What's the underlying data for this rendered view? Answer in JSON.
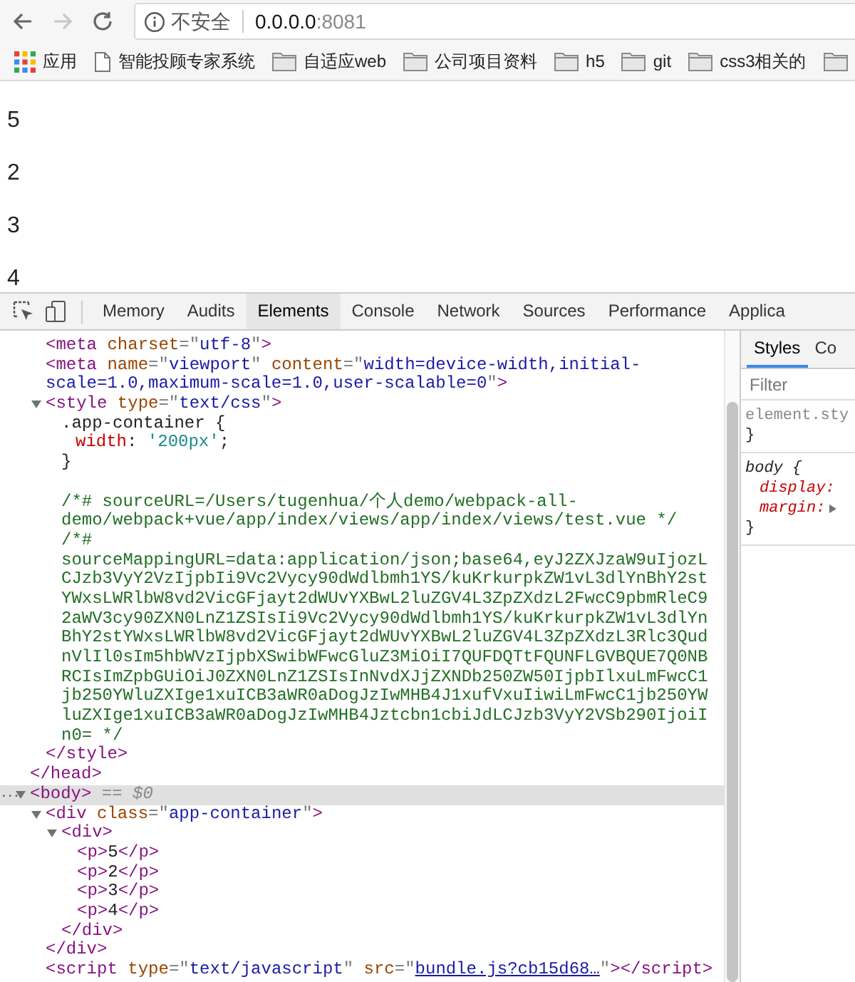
{
  "browser": {
    "nav_buttons": [
      {
        "kind": "back",
        "disabled": false
      },
      {
        "kind": "forward",
        "disabled": true
      },
      {
        "kind": "reload",
        "disabled": false
      }
    ],
    "security_label": "不安全",
    "url_host": "0.0.0.0",
    "url_port": ":8081"
  },
  "bookmarks": [
    {
      "kind": "apps",
      "label": "应用"
    },
    {
      "kind": "page",
      "label": "智能投顾专家系统"
    },
    {
      "kind": "folder",
      "label": "自适应web"
    },
    {
      "kind": "folder",
      "label": "公司项目资料"
    },
    {
      "kind": "folder",
      "label": "h5"
    },
    {
      "kind": "folder",
      "label": "git"
    },
    {
      "kind": "folder",
      "label": "css3相关的"
    },
    {
      "kind": "folder"
    }
  ],
  "page": {
    "paragraphs": [
      "5",
      "2",
      "3",
      "4"
    ]
  },
  "devtools": {
    "tabs": [
      {
        "label": "Memory",
        "selected": false
      },
      {
        "label": "Audits",
        "selected": false
      },
      {
        "label": "Elements",
        "selected": true
      },
      {
        "label": "Console",
        "selected": false
      },
      {
        "label": "Network",
        "selected": false
      },
      {
        "label": "Sources",
        "selected": false
      },
      {
        "label": "Performance",
        "selected": false
      },
      {
        "label": "Applica",
        "selected": false
      }
    ],
    "dom_tree": [
      {
        "selected": false,
        "children": [
          {
            "selected": false,
            "lines": [
              {
                "parts": [
                  {
                    "kind": "tag",
                    "text": "<meta"
                  },
                  {
                    "kind": "attr",
                    "text": " charset"
                  },
                  {
                    "kind": "punct",
                    "text": "=\""
                  },
                  {
                    "kind": "value",
                    "text": "utf-8"
                  },
                  {
                    "kind": "punct",
                    "text": "\""
                  },
                  {
                    "kind": "tag",
                    "text": ">"
                  }
                ]
              }
            ]
          },
          {
            "selected": false,
            "lines": [
              {
                "parts": [
                  {
                    "kind": "tag",
                    "text": "<meta"
                  },
                  {
                    "kind": "attr",
                    "text": " name"
                  },
                  {
                    "kind": "punct",
                    "text": "=\""
                  },
                  {
                    "kind": "value",
                    "text": "viewport"
                  },
                  {
                    "kind": "punct",
                    "text": "\""
                  },
                  {
                    "kind": "attr",
                    "text": " content"
                  },
                  {
                    "kind": "punct",
                    "text": "=\""
                  },
                  {
                    "kind": "value",
                    "text": "width=device-width,initial-"
                  }
                ]
              },
              {
                "parts": [
                  {
                    "kind": "value",
                    "text": "scale=1.0,maximum-scale=1.0,user-scalable=0"
                  },
                  {
                    "kind": "punct",
                    "text": "\""
                  },
                  {
                    "kind": "tag",
                    "text": ">"
                  }
                ]
              }
            ]
          },
          {
            "selected": false,
            "expanded": true,
            "lines": [
              {
                "parts": [
                  {
                    "kind": "tag",
                    "text": "<style"
                  },
                  {
                    "kind": "attr",
                    "text": " type"
                  },
                  {
                    "kind": "punct",
                    "text": "=\""
                  },
                  {
                    "kind": "value",
                    "text": "text/css"
                  },
                  {
                    "kind": "punct",
                    "text": "\""
                  },
                  {
                    "kind": "tag",
                    "text": ">"
                  }
                ]
              }
            ],
            "children": [
              {
                "selected": false,
                "lines": [
                  {
                    "parts": [
                      {
                        "kind": "selector",
                        "text": ".app-container {"
                      }
                    ]
                  },
                  {
                    "indented": true,
                    "parts": [
                      {
                        "kind": "property",
                        "text": "width"
                      },
                      {
                        "kind": "text",
                        "text": ": "
                      },
                      {
                        "kind": "string",
                        "text": "'200px'"
                      },
                      {
                        "kind": "text",
                        "text": ";"
                      }
                    ]
                  },
                  {
                    "parts": [
                      {
                        "kind": "text",
                        "text": "}"
                      }
                    ]
                  }
                ]
              },
              {
                "selected": false,
                "blank_before": true,
                "lines": [
                  {
                    "parts": [
                      {
                        "kind": "comment",
                        "text": "/*# sourceURL=/Users/tugenhua/个人demo/webpack-all-"
                      }
                    ]
                  },
                  {
                    "parts": [
                      {
                        "kind": "comment",
                        "text": "demo/webpack+vue/app/index/views/app/index/views/test.vue */"
                      }
                    ]
                  },
                  {
                    "parts": [
                      {
                        "kind": "comment",
                        "text": "/*#"
                      }
                    ]
                  },
                  {
                    "parts": [
                      {
                        "kind": "comment",
                        "text": "sourceMappingURL=data:application/json;base64,eyJ2ZXJzaW9uIjozL"
                      }
                    ]
                  },
                  {
                    "parts": [
                      {
                        "kind": "comment",
                        "text": "CJzb3VyY2VzIjpbIi9Vc2Vycy90dWdlbmh1YS/kuKrkurpkZW1vL3dlYnBhY2st"
                      }
                    ]
                  },
                  {
                    "parts": [
                      {
                        "kind": "comment",
                        "text": "YWxsLWRlbW8vd2VicGFjayt2dWUvYXBwL2luZGV4L3ZpZXdzL2FwcC9pbmRleC9"
                      }
                    ]
                  },
                  {
                    "parts": [
                      {
                        "kind": "comment",
                        "text": "2aWV3cy90ZXN0LnZ1ZSIsIi9Vc2Vycy90dWdlbmh1YS/kuKrkurpkZW1vL3dlYn"
                      }
                    ]
                  },
                  {
                    "parts": [
                      {
                        "kind": "comment",
                        "text": "BhY2stYWxsLWRlbW8vd2VicGFjayt2dWUvYXBwL2luZGV4L3ZpZXdzL3Rlc3Qud"
                      }
                    ]
                  },
                  {
                    "parts": [
                      {
                        "kind": "comment",
                        "text": "nVlIl0sIm5hbWVzIjpbXSwibWFwcGluZ3MiOiI7QUFDQTtFQUNFLGVBQUE7Q0NB"
                      }
                    ]
                  },
                  {
                    "parts": [
                      {
                        "kind": "comment",
                        "text": "RCIsImZpbGUiOiJ0ZXN0LnZ1ZSIsInNvdXJjZXNDb250ZW50IjpbIlxuLmFwcC1"
                      }
                    ]
                  },
                  {
                    "parts": [
                      {
                        "kind": "comment",
                        "text": "jb250YWluZXIge1xuICB3aWR0aDogJzIwMHB4J1xufVxuIiwiLmFwcC1jb250YW"
                      }
                    ]
                  },
                  {
                    "parts": [
                      {
                        "kind": "comment",
                        "text": "luZXIge1xuICB3aWR0aDogJzIwMHB4Jztcbn1cbiJdLCJzb3VyY2VSb290IjoiI"
                      }
                    ]
                  },
                  {
                    "parts": [
                      {
                        "kind": "comment",
                        "text": "n0= */"
                      }
                    ]
                  }
                ]
              }
            ],
            "close": [
              {
                "kind": "tag",
                "text": "</style>"
              }
            ]
          }
        ],
        "close": [
          {
            "kind": "tag",
            "text": "</head>"
          }
        ]
      },
      {
        "selected": true,
        "gutter": "...",
        "expanded": true,
        "lines": [
          {
            "parts": [
              {
                "kind": "tag",
                "text": "<body>"
              },
              {
                "kind": "note",
                "text": " == $0"
              }
            ]
          }
        ],
        "children": [
          {
            "selected": false,
            "expanded": true,
            "lines": [
              {
                "parts": [
                  {
                    "kind": "tag",
                    "text": "<div"
                  },
                  {
                    "kind": "attr",
                    "text": " class"
                  },
                  {
                    "kind": "punct",
                    "text": "=\""
                  },
                  {
                    "kind": "value",
                    "text": "app-container"
                  },
                  {
                    "kind": "punct",
                    "text": "\""
                  },
                  {
                    "kind": "tag",
                    "text": ">"
                  }
                ]
              }
            ],
            "children": [
              {
                "selected": false,
                "expanded": true,
                "lines": [
                  {
                    "parts": [
                      {
                        "kind": "tag",
                        "text": "<div>"
                      }
                    ]
                  }
                ],
                "children": [
                  {
                    "selected": false,
                    "lines": [
                      {
                        "parts": [
                          {
                            "kind": "tag",
                            "text": "<p>"
                          },
                          {
                            "kind": "text",
                            "text": "5"
                          },
                          {
                            "kind": "tag",
                            "text": "</p>"
                          }
                        ]
                      }
                    ]
                  },
                  {
                    "selected": false,
                    "lines": [
                      {
                        "parts": [
                          {
                            "kind": "tag",
                            "text": "<p>"
                          },
                          {
                            "kind": "text",
                            "text": "2"
                          },
                          {
                            "kind": "tag",
                            "text": "</p>"
                          }
                        ]
                      }
                    ]
                  },
                  {
                    "selected": false,
                    "lines": [
                      {
                        "parts": [
                          {
                            "kind": "tag",
                            "text": "<p>"
                          },
                          {
                            "kind": "text",
                            "text": "3"
                          },
                          {
                            "kind": "tag",
                            "text": "</p>"
                          }
                        ]
                      }
                    ]
                  },
                  {
                    "selected": false,
                    "lines": [
                      {
                        "parts": [
                          {
                            "kind": "tag",
                            "text": "<p>"
                          },
                          {
                            "kind": "text",
                            "text": "4"
                          },
                          {
                            "kind": "tag",
                            "text": "</p>"
                          }
                        ]
                      }
                    ]
                  }
                ],
                "close": [
                  {
                    "kind": "tag",
                    "text": "</div>"
                  }
                ]
              }
            ],
            "close": [
              {
                "kind": "tag",
                "text": "</div>"
              }
            ]
          },
          {
            "selected": false,
            "lines": [
              {
                "parts": [
                  {
                    "kind": "tag",
                    "text": "<script"
                  },
                  {
                    "kind": "attr",
                    "text": " type"
                  },
                  {
                    "kind": "punct",
                    "text": "=\""
                  },
                  {
                    "kind": "value",
                    "text": "text/javascript"
                  },
                  {
                    "kind": "punct",
                    "text": "\""
                  },
                  {
                    "kind": "attr",
                    "text": " src"
                  },
                  {
                    "kind": "punct",
                    "text": "=\""
                  },
                  {
                    "kind": "link",
                    "text": "bundle.js?cb15d68…"
                  },
                  {
                    "kind": "punct",
                    "text": "\""
                  },
                  {
                    "kind": "tag",
                    "text": "></script>"
                  }
                ]
              }
            ]
          }
        ]
      }
    ],
    "sidebar": {
      "tabs": [
        {
          "label": "Styles",
          "selected": true
        },
        {
          "label": "Co",
          "selected": false
        }
      ],
      "filter": {
        "placeholder": "Filter"
      },
      "rules": [
        {
          "kind": "inline",
          "selector": "element.sty",
          "close": "}"
        },
        {
          "kind": "user-agent",
          "selector": "body {",
          "declarations": [
            {
              "property": "display:",
              "expandable": false
            },
            {
              "property": "margin:",
              "expandable": true
            }
          ],
          "close": "}"
        }
      ]
    }
  }
}
